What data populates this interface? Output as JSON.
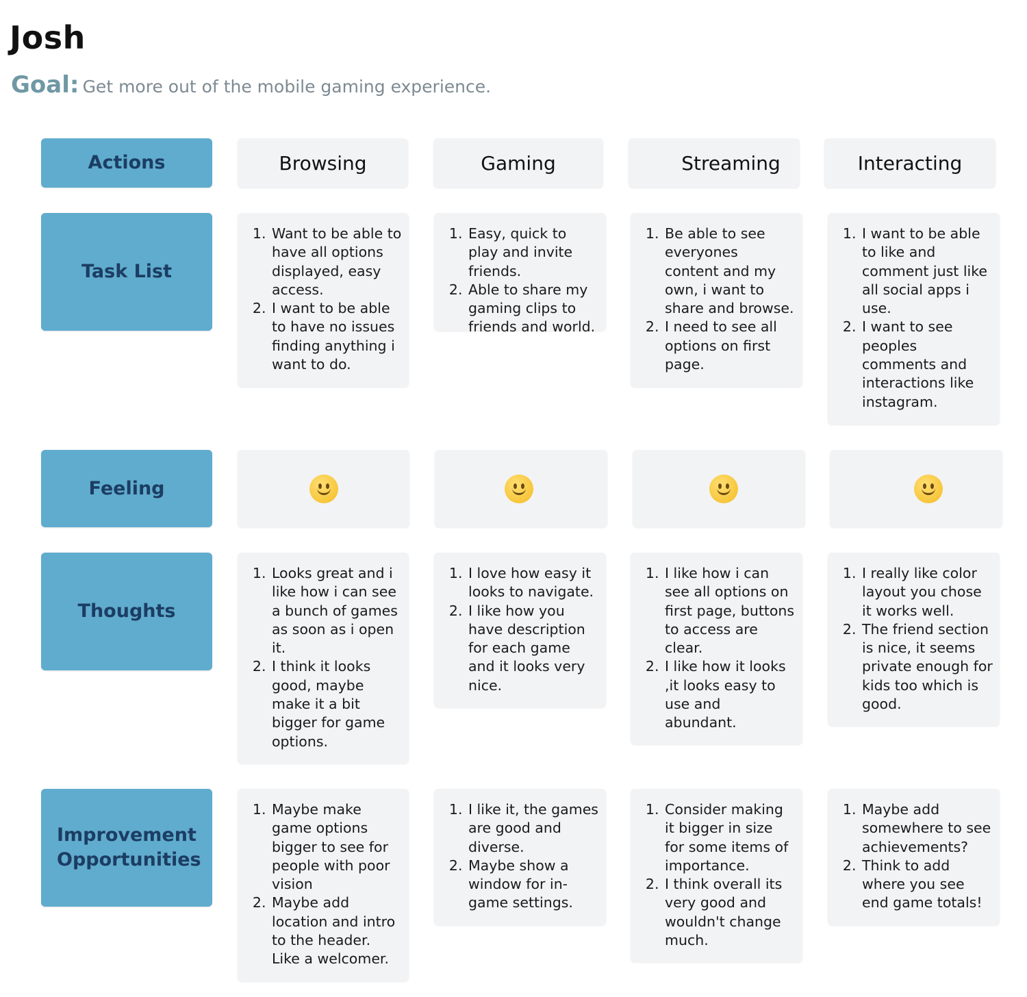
{
  "persona": {
    "name": "Josh",
    "goal_label": "Goal:",
    "goal_text": "Get more out of the mobile gaming experience."
  },
  "rows": {
    "actions": "Actions",
    "task_list": "Task List",
    "feeling": "Feeling",
    "thoughts": "Thoughts",
    "improvement": "Improvement Opportunities"
  },
  "stages": [
    "Browsing",
    "Gaming",
    "Streaming",
    "Interacting"
  ],
  "task_list": [
    [
      "Want to be able to have all options displayed, easy access.",
      "I want to be able to have no issues finding anything i want to do."
    ],
    [
      "Easy, quick to play and invite friends.",
      "Able to share my gaming clips to friends and world."
    ],
    [
      "Be able to see everyones content and my own, i want to share and browse.",
      "I need to see all options on first page."
    ],
    [
      "I want to be able to like and comment just like all social apps i use.",
      "I want to see peoples comments and interactions like instagram."
    ]
  ],
  "feeling": [
    "smiley-face-icon",
    "smiley-face-icon",
    "smiley-face-icon",
    "smiley-face-icon"
  ],
  "thoughts": [
    [
      "Looks great and i like how i can see a bunch of games as soon as i open it.",
      "I think it looks good, maybe make it a bit bigger for game options."
    ],
    [
      "I love how easy it looks to navigate.",
      "I like how you have description for each game and it looks very nice."
    ],
    [
      "I like how i can see all options on first page, buttons to access are clear.",
      "I like how it looks ,it looks easy to use and abundant."
    ],
    [
      "I really like color layout you chose it works well.",
      "The friend section is nice, it seems private enough for kids too which is good."
    ]
  ],
  "improvements": [
    [
      "Maybe make game options bigger to see for people with poor vision",
      "Maybe add location and intro to the header. Like a welcomer."
    ],
    [
      "I like it, the games are good and diverse.",
      "Maybe show a window for in-game settings."
    ],
    [
      "Consider making it bigger in size for some items of importance.",
      "I think overall its very good and wouldn't change much."
    ],
    [
      "Maybe add somewhere to see achievements?",
      "Think to add where you see end game totals!"
    ]
  ],
  "colors": {
    "label_bg": "#60acce",
    "label_text": "#1c3d63",
    "card_bg": "#f2f3f5",
    "goal_accent": "#6f98a4"
  }
}
